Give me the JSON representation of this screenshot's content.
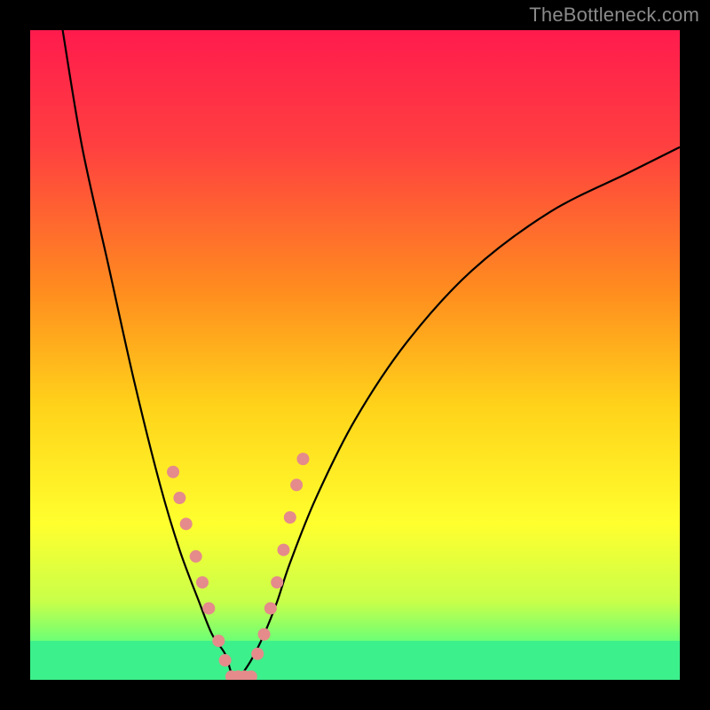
{
  "watermark": "TheBottleneck.com",
  "chart_data": {
    "type": "line",
    "title": "",
    "xlabel": "",
    "ylabel": "",
    "xlim": [
      0,
      100
    ],
    "ylim": [
      0,
      100
    ],
    "grid": false,
    "legend": false,
    "background_gradient": {
      "stops": [
        {
          "offset": 0,
          "color": "#ff1b4d"
        },
        {
          "offset": 18,
          "color": "#ff4040"
        },
        {
          "offset": 40,
          "color": "#ff8c1f"
        },
        {
          "offset": 58,
          "color": "#ffd31a"
        },
        {
          "offset": 76,
          "color": "#ffff2e"
        },
        {
          "offset": 88,
          "color": "#c8ff4a"
        },
        {
          "offset": 95,
          "color": "#5dff7c"
        },
        {
          "offset": 100,
          "color": "#22e08f"
        }
      ]
    },
    "bottom_band": {
      "y_from": 94,
      "y_to": 100,
      "color": "#3cf08b"
    },
    "series": [
      {
        "name": "left-branch",
        "x": [
          5,
          8,
          12,
          16,
          20,
          23,
          26,
          28,
          30,
          31,
          32
        ],
        "y": [
          0,
          18,
          36,
          54,
          70,
          80,
          88,
          93,
          96,
          99,
          100
        ]
      },
      {
        "name": "right-branch",
        "x": [
          32,
          34,
          36,
          38,
          40,
          44,
          50,
          58,
          68,
          80,
          92,
          100
        ],
        "y": [
          100,
          97,
          93,
          88,
          82,
          72,
          60,
          48,
          37,
          28,
          22,
          18
        ]
      }
    ],
    "notch_points": {
      "left": [
        {
          "x": 22,
          "y": 68
        },
        {
          "x": 23,
          "y": 72
        },
        {
          "x": 24,
          "y": 76
        },
        {
          "x": 25.5,
          "y": 81
        },
        {
          "x": 26.5,
          "y": 85
        },
        {
          "x": 27.5,
          "y": 89
        },
        {
          "x": 29,
          "y": 94
        },
        {
          "x": 30,
          "y": 97
        }
      ],
      "right": [
        {
          "x": 35,
          "y": 96
        },
        {
          "x": 36,
          "y": 93
        },
        {
          "x": 37,
          "y": 89
        },
        {
          "x": 38,
          "y": 85
        },
        {
          "x": 39,
          "y": 80
        },
        {
          "x": 40,
          "y": 75
        },
        {
          "x": 41,
          "y": 70
        },
        {
          "x": 42,
          "y": 66
        }
      ],
      "bottom": [
        {
          "x": 31,
          "y": 99.5
        },
        {
          "x": 32,
          "y": 99.5
        },
        {
          "x": 33,
          "y": 99.5
        },
        {
          "x": 34,
          "y": 99.5
        }
      ]
    }
  }
}
